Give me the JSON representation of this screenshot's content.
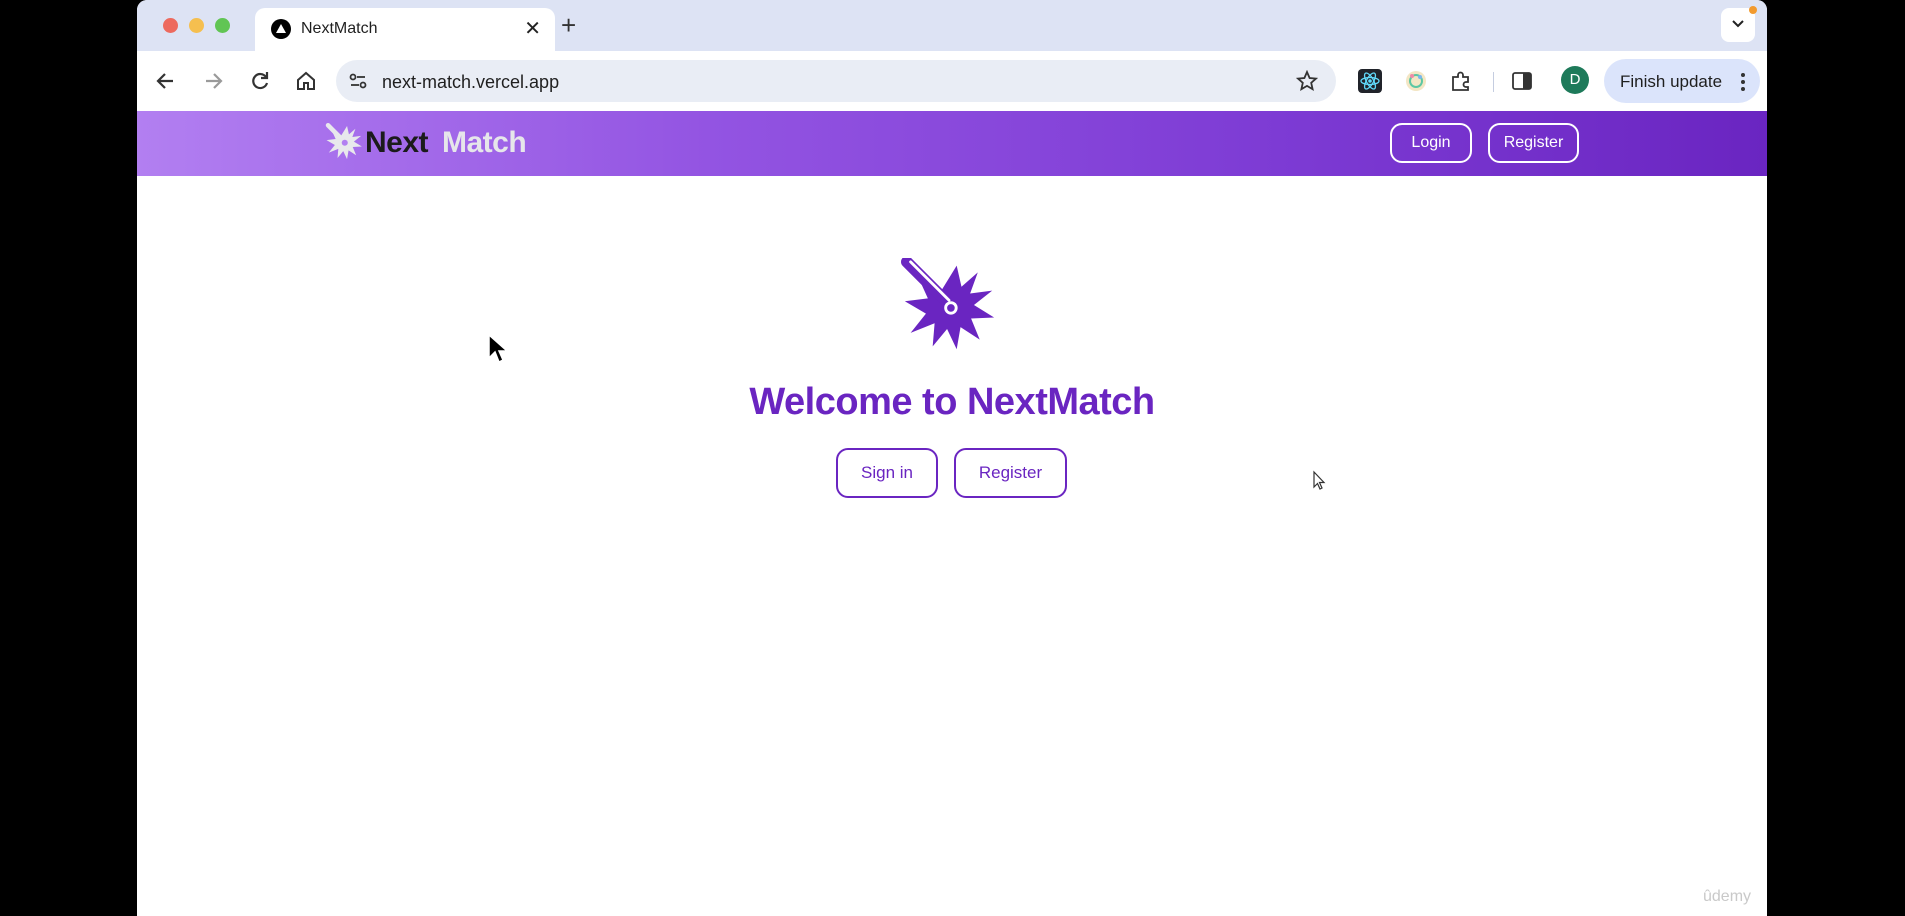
{
  "browser": {
    "tab_title": "NextMatch",
    "url": "next-match.vercel.app",
    "profile_initial": "D",
    "finish_update_label": "Finish update"
  },
  "navbar": {
    "brand_part1": "Next",
    "brand_part2": "Match",
    "login_label": "Login",
    "register_label": "Register"
  },
  "hero": {
    "title": "Welcome to NextMatch",
    "signin_label": "Sign in",
    "register_label": "Register"
  },
  "watermark": "ûdemy",
  "colors": {
    "brand_purple": "#6a25c1",
    "navbar_gradient_start": "#b27ff1",
    "navbar_gradient_end": "#6a25c1"
  }
}
